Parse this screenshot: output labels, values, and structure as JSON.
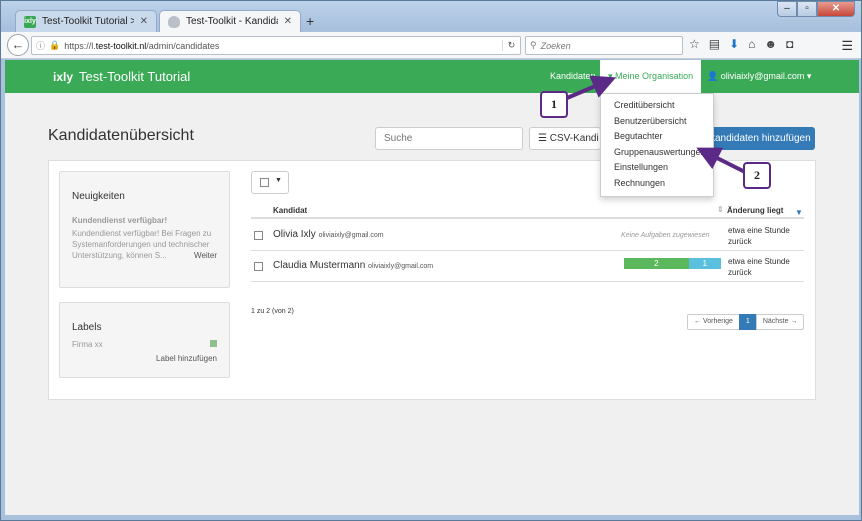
{
  "browser": {
    "tabs": [
      {
        "title": "Test-Toolkit Tutorial > Ixly",
        "icon": "ixly-favicon",
        "favicon_text": "ixly"
      },
      {
        "title": "Test-Toolkit - Kandidatenü...",
        "icon": "shield-favicon"
      }
    ],
    "url_prefix": "https://l.",
    "url_domain": "test-toolkit.nl",
    "url_path": "/admin/candidates",
    "search_placeholder": "Zoeken"
  },
  "navbar": {
    "logo": "ixly",
    "title": "Test-Toolkit Tutorial",
    "kandidaten": "Kandidaten",
    "organisation": "Meine Organisation",
    "user": "oliviaixly@gmail.com",
    "accent_color": "#3aaa56"
  },
  "dropdown": {
    "items": [
      "Creditübersicht",
      "Benutzerübersicht",
      "Begutachter",
      "Gruppenauswertungen",
      "Einstellungen",
      "Rechnungen"
    ]
  },
  "page": {
    "title": "Kandidatenübersicht",
    "search_placeholder": "Suche",
    "csv_label": "CSV-Kandi",
    "add_label": "kandidaten hinzufügen"
  },
  "news": {
    "title": "Neuigkeiten",
    "headline": "Kundendienst verfügbar!",
    "body": "Kundendienst verfügbar! Bei Fragen zu Systemanforderungen und technischer Unterstützung, können S...",
    "more": "Weiter"
  },
  "labels": {
    "title": "Labels",
    "item": "Firma xx",
    "add": "Label hinzufügen"
  },
  "table": {
    "col_candidate": "Kandidat",
    "col_change": "Änderung liegt",
    "rows": [
      {
        "name": "Olivia Ixly",
        "email": "oliviaixly@gmail.com",
        "note": "Keine Aufgaben zugewiesen",
        "time": "etwa eine Stunde zurück"
      },
      {
        "name": "Claudia Mustermann",
        "email": "oliviaixly@gmail.com",
        "progress_green": 2,
        "progress_blue": 1,
        "time": "etwa eine Stunde zurück"
      }
    ]
  },
  "pagination": {
    "info": "1 zu 2 (von 2)",
    "prev": "← Vorherige",
    "current": "1",
    "next": "Nächste →"
  },
  "annotations": {
    "callout1": "1",
    "callout2": "2"
  }
}
